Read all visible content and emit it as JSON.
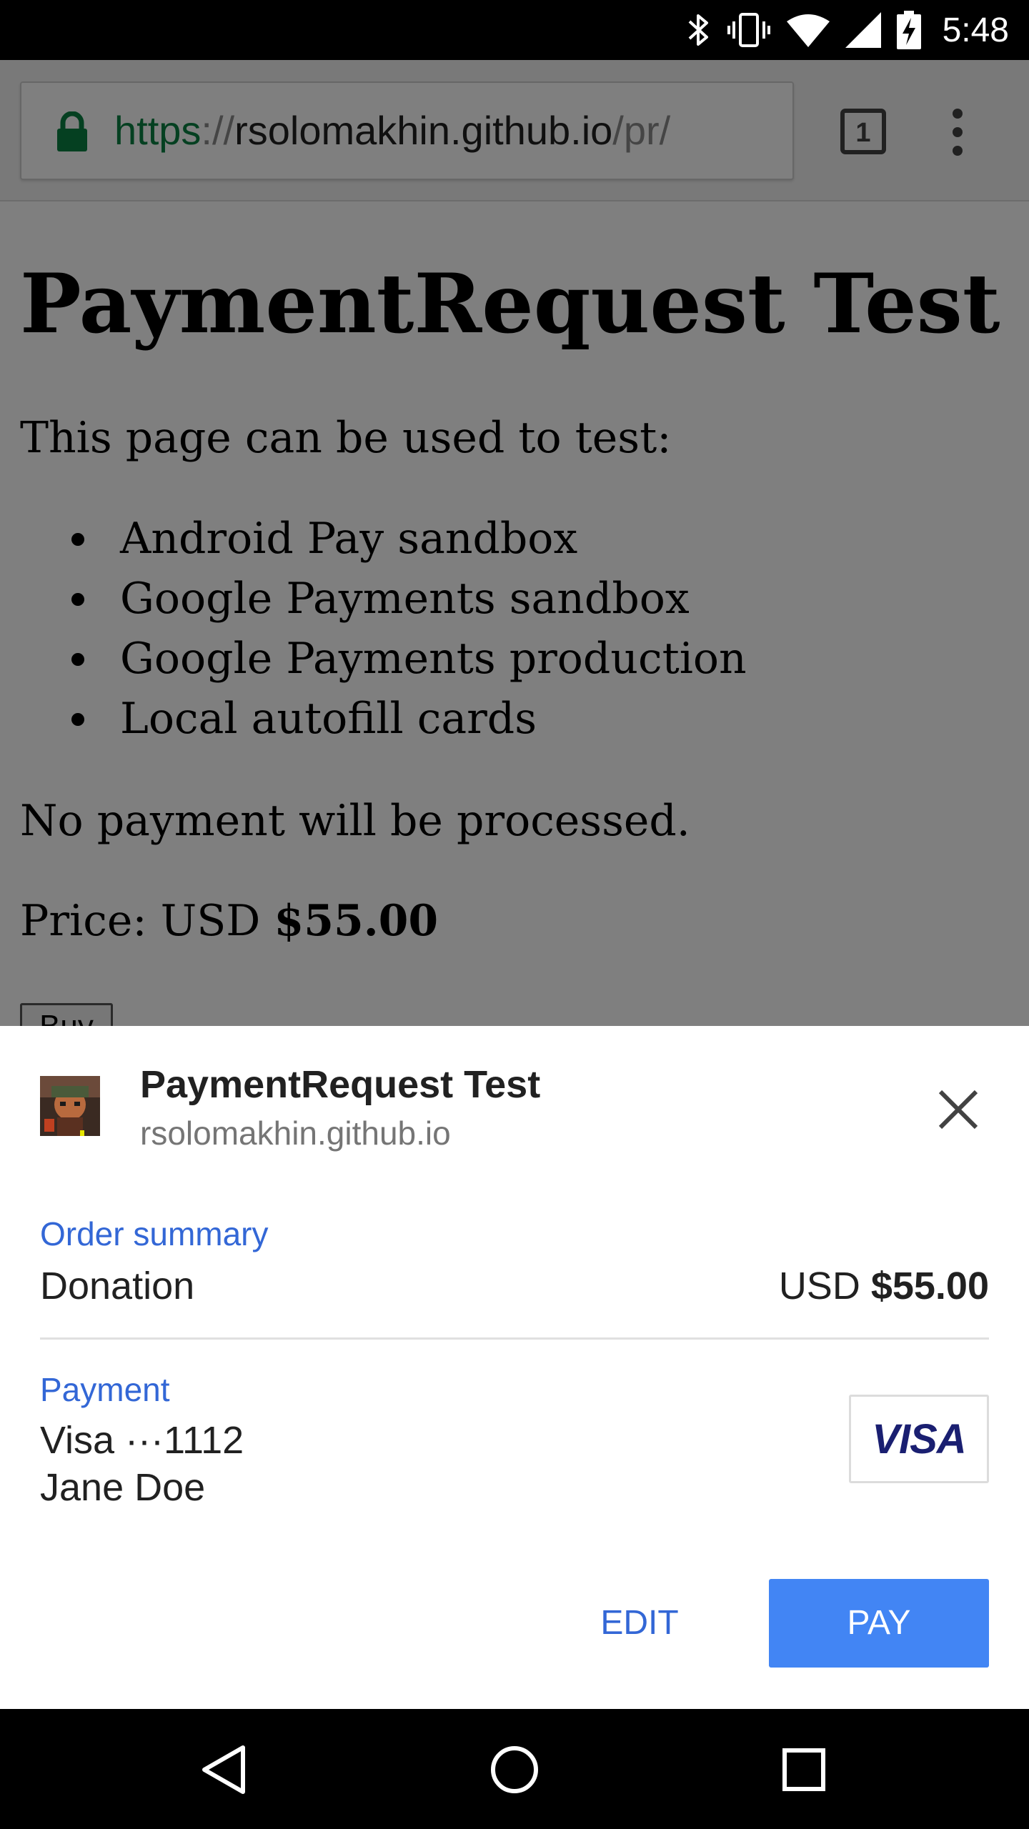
{
  "status_bar": {
    "time": "5:48",
    "icons": [
      "bluetooth-icon",
      "vibrate-icon",
      "wifi-icon",
      "signal-icon",
      "battery-charging-icon"
    ]
  },
  "browser": {
    "url": {
      "scheme": "https",
      "separator": "://",
      "host": "rsolomakhin.github.io",
      "path": "/pr/"
    },
    "tab_count": "1",
    "icons": {
      "lock": "lock-icon",
      "menu": "overflow-menu-icon"
    }
  },
  "page": {
    "title": "PaymentRequest Test",
    "intro": "This page can be used to test:",
    "features": [
      "Android Pay sandbox",
      "Google Payments sandbox",
      "Google Payments production",
      "Local autofill cards"
    ],
    "note": "No payment will be processed.",
    "price_label": "Price: USD ",
    "price_value": "$55.00",
    "buy_label": "Buy"
  },
  "payment_sheet": {
    "merchant_title": "PaymentRequest Test",
    "merchant_origin": "rsolomakhin.github.io",
    "order_summary_label": "Order summary",
    "order_item": "Donation",
    "order_currency": "USD ",
    "order_total": "$55.00",
    "payment_label": "Payment",
    "card": "Visa ···1112",
    "cardholder": "Jane Doe",
    "card_brand": "VISA",
    "edit_label": "EDIT",
    "pay_label": "PAY"
  },
  "colors": {
    "accent": "#4285f4",
    "link": "#3367d6",
    "secure_green": "#0b8043",
    "visa_blue": "#1a1f71"
  },
  "nav_bar": {
    "icons": [
      "back-icon",
      "home-icon",
      "recents-icon"
    ]
  }
}
